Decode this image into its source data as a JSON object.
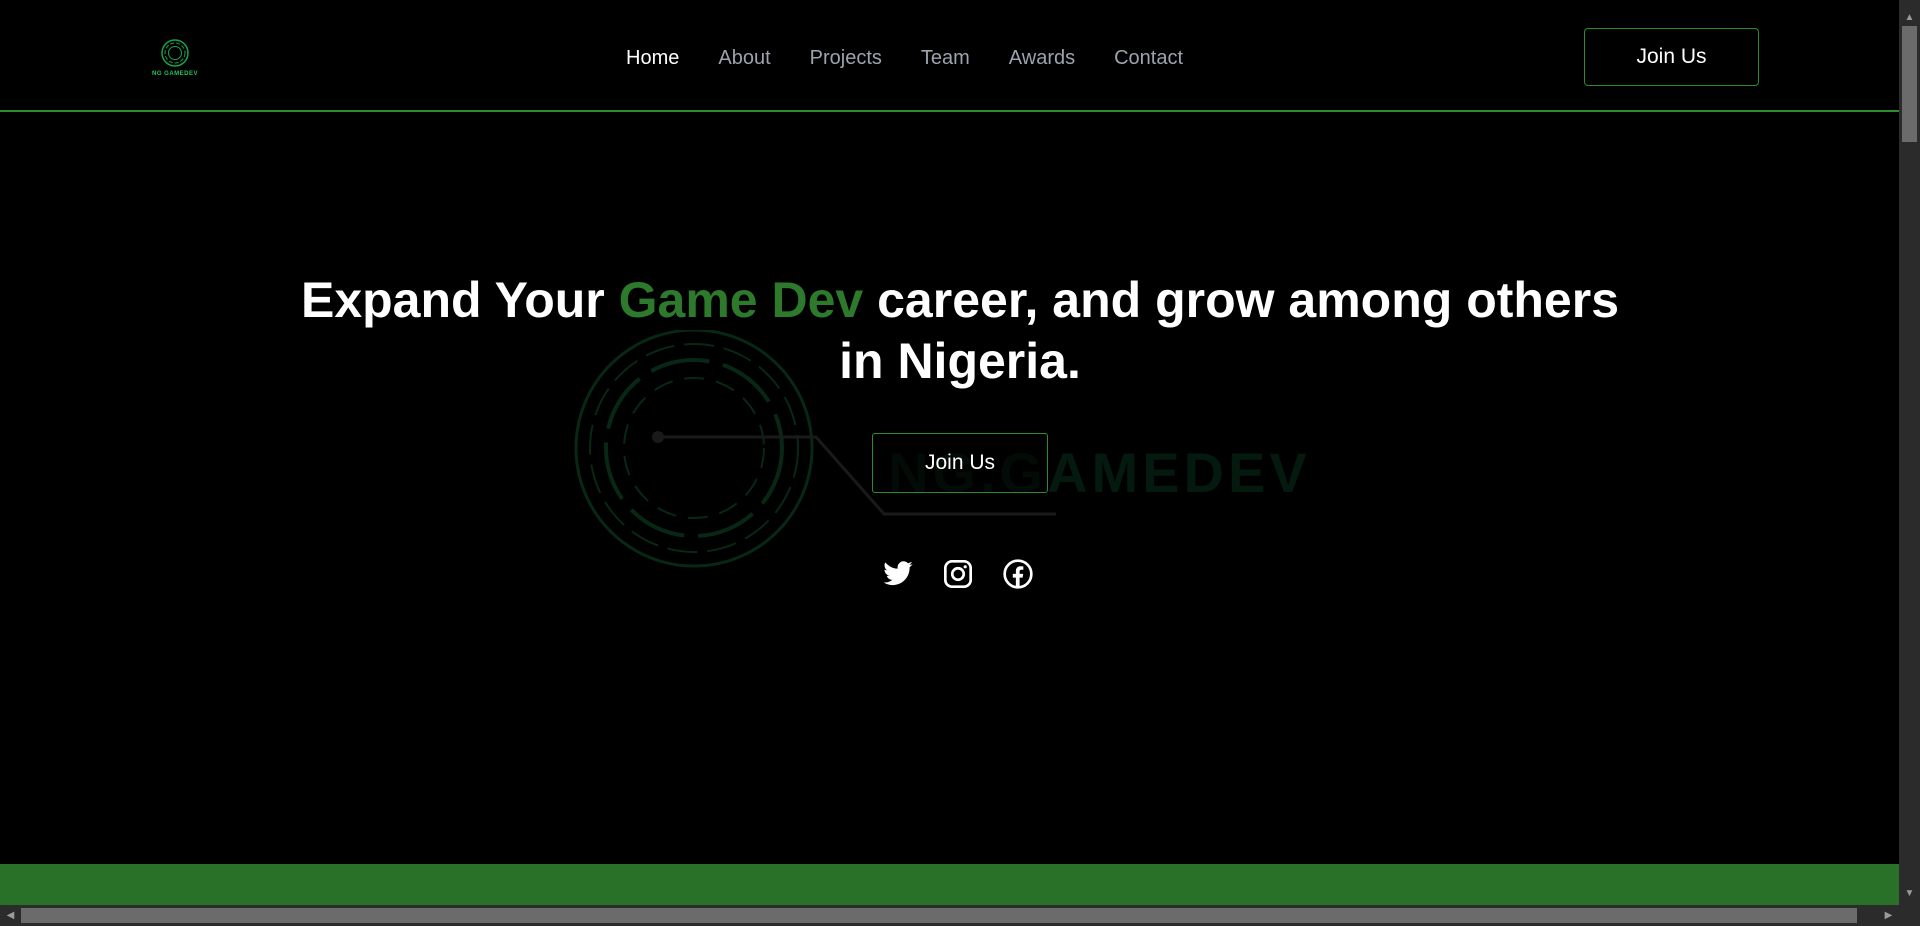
{
  "top_strip": {
    "color": "#2a2d31"
  },
  "header": {
    "logo": {
      "text": "NG GAMEDEV",
      "icon": "ring-logo-icon",
      "color": "#22c55e"
    },
    "nav": [
      {
        "label": "Home",
        "active": true
      },
      {
        "label": "About",
        "active": false
      },
      {
        "label": "Projects",
        "active": false
      },
      {
        "label": "Team",
        "active": false
      },
      {
        "label": "Awards",
        "active": false
      },
      {
        "label": "Contact",
        "active": false
      }
    ],
    "join_label": "Join Us",
    "border_color": "#2e8b2e"
  },
  "hero": {
    "title_before": "Expand Your ",
    "title_accent": "Game Dev",
    "title_after": " career, and grow among others in Nigeria.",
    "accent_color": "#2d7a2d",
    "watermark_text": "NG.GAMEDEV",
    "join_label": "Join Us",
    "socials": [
      {
        "name": "twitter-icon"
      },
      {
        "name": "instagram-icon"
      },
      {
        "name": "facebook-icon"
      }
    ]
  },
  "footer_band": {
    "color": "#297029"
  },
  "scrollbars": {
    "vertical_arrow_up": "▲",
    "vertical_arrow_down": "▼",
    "horizontal_arrow_left": "◀",
    "horizontal_arrow_right": "▶"
  }
}
